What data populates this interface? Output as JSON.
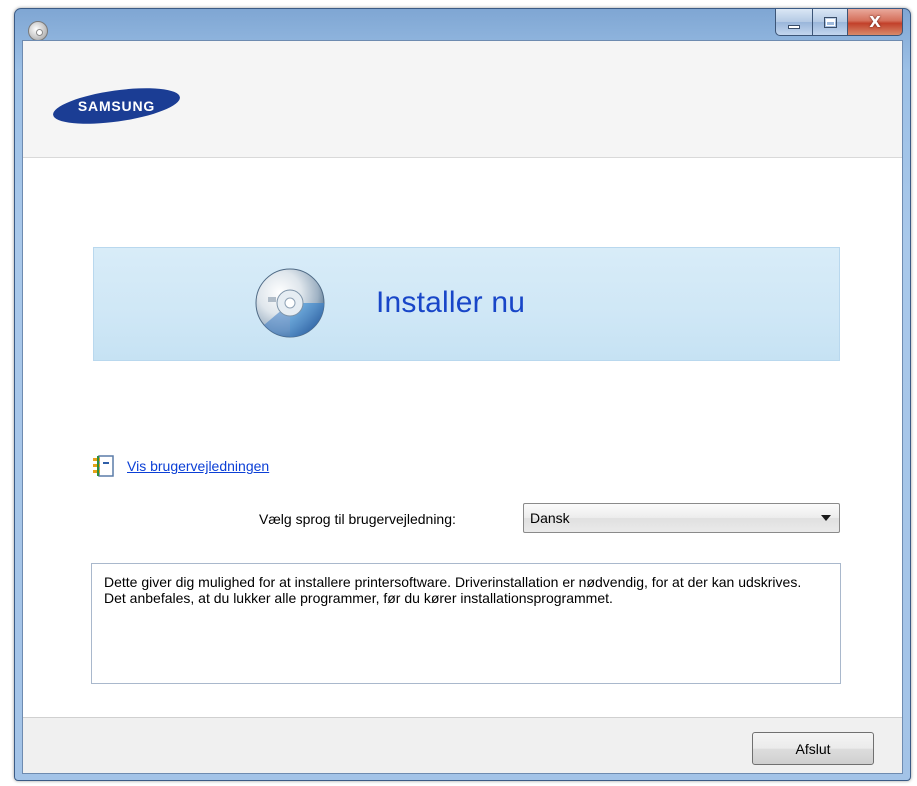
{
  "window": {
    "close_glyph": "X",
    "app_icon": "cd-disc-icon"
  },
  "header": {
    "logo_text": "SAMSUNG"
  },
  "install": {
    "label": "Installer nu",
    "icon": "cd-disc-icon"
  },
  "manual": {
    "link_text": "Vis brugervejledningen",
    "icon": "notebook-icon"
  },
  "language": {
    "label": "Vælg sprog til brugervejledning:",
    "selected": "Dansk"
  },
  "description": {
    "line1": "Dette giver dig mulighed for at installere printersoftware. Driverinstallation er nødvendig, for at der kan udskrives.",
    "line2": "Det anbefales, at du lukker alle programmer, før du kører installationsprogrammet."
  },
  "footer": {
    "exit_label": "Afslut"
  },
  "colors": {
    "accent_link": "#0b3fd6",
    "install_text": "#1846c8",
    "banner_bg": "#cfe7f6",
    "samsung_blue": "#1b3d94"
  }
}
